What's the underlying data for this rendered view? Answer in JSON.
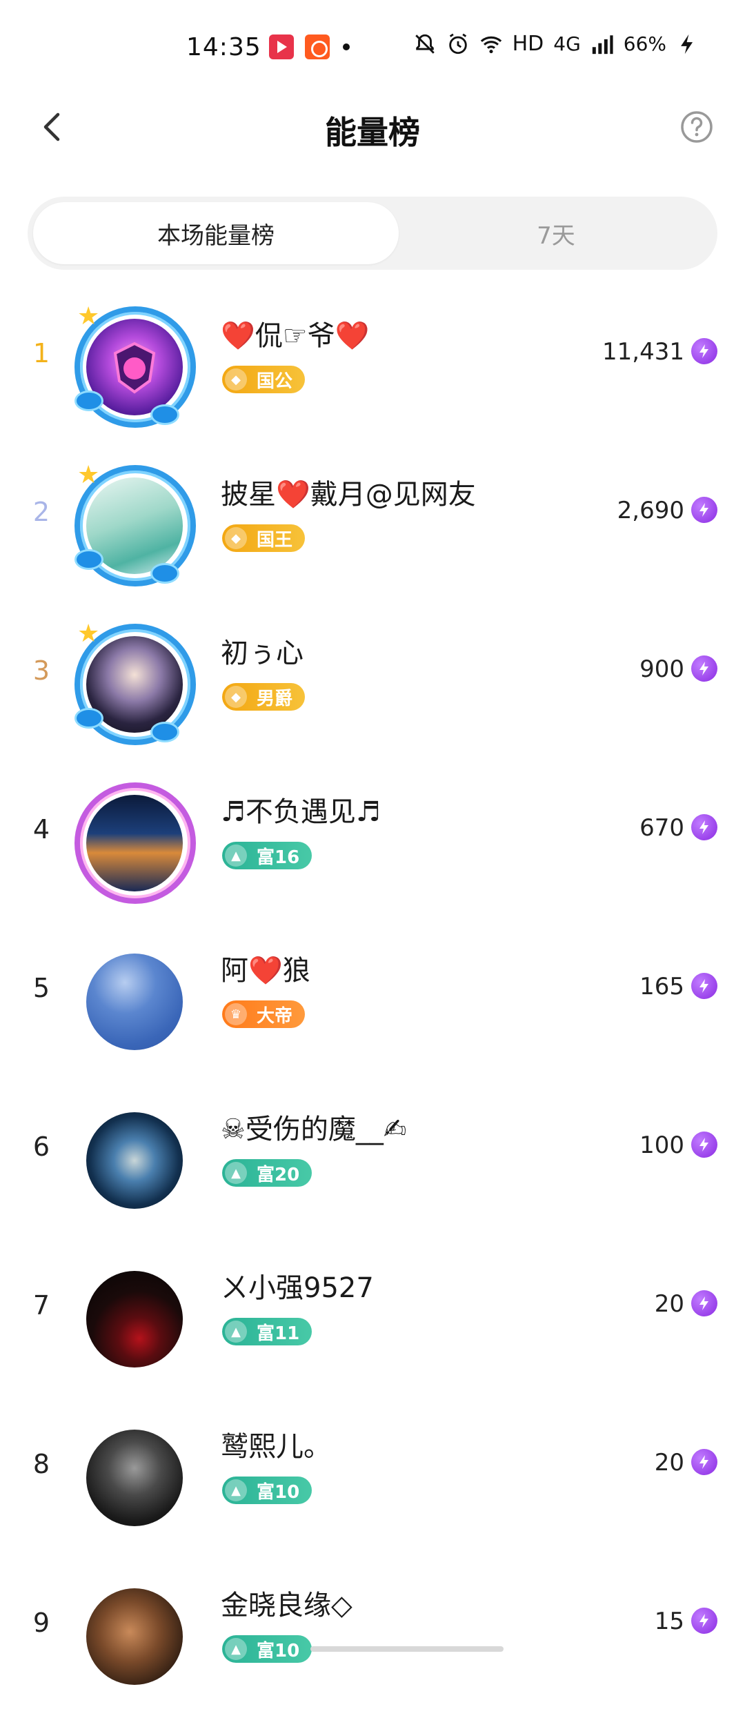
{
  "status_bar": {
    "time": "14:35",
    "network": "HD",
    "signal": "4G",
    "battery": "66%"
  },
  "header": {
    "title": "能量榜",
    "back_icon": "chevron-left-icon",
    "help_icon": "question-circle-icon"
  },
  "tabs": [
    {
      "label": "本场能量榜",
      "active": true
    },
    {
      "label": "7天",
      "active": false
    }
  ],
  "colors": {
    "rank_1": "#f3b21b",
    "rank_2": "#a9b5e8",
    "rank_3": "#d49a5a",
    "rank_default": "#222222",
    "energy": "#8a2be2"
  },
  "rows": [
    {
      "rank": "1",
      "name": "❤️侃☞爷❤️",
      "badge": "国公",
      "badge_style": "gold",
      "score": "11,431"
    },
    {
      "rank": "2",
      "name": "披星❤️戴月@见网友",
      "badge": "国王",
      "badge_style": "gold",
      "score": "2,690"
    },
    {
      "rank": "3",
      "name": "初ぅ心",
      "badge": "男爵",
      "badge_style": "gold",
      "score": "900"
    },
    {
      "rank": "4",
      "name": "♬不负遇见♬",
      "badge": "富16",
      "badge_style": "teal",
      "score": "670"
    },
    {
      "rank": "5",
      "name": "阿❤️狼",
      "badge": "大帝",
      "badge_style": "orange",
      "score": "165"
    },
    {
      "rank": "6",
      "name": "☠受伤的魔__✍",
      "badge": "富20",
      "badge_style": "teal",
      "score": "100"
    },
    {
      "rank": "7",
      "name": "ㄨ小强9527",
      "badge": "富11",
      "badge_style": "teal",
      "score": "20"
    },
    {
      "rank": "8",
      "name": "鹫熙儿。",
      "badge": "富10",
      "badge_style": "teal",
      "score": "20"
    },
    {
      "rank": "9",
      "name": "金晓良缘◇",
      "badge": "富10",
      "badge_style": "teal",
      "score": "15"
    }
  ]
}
